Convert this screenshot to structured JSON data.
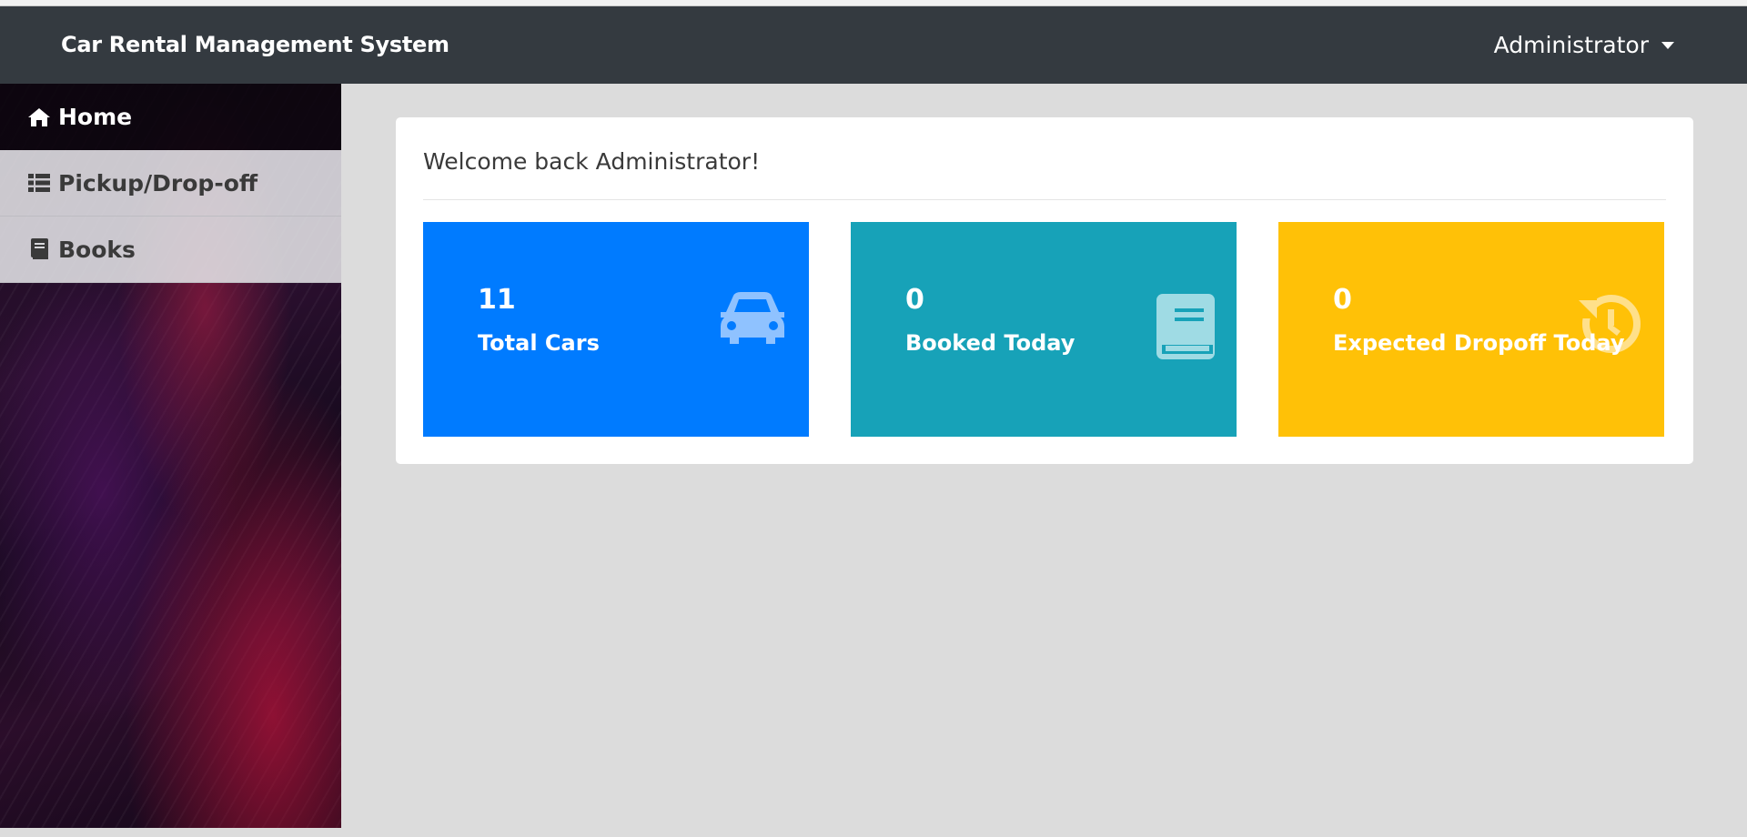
{
  "header": {
    "brand": "Car Rental Management System",
    "user": "Administrator"
  },
  "sidebar": {
    "items": [
      {
        "label": "Home",
        "icon": "home-icon",
        "active": true
      },
      {
        "label": "Pickup/Drop-off",
        "icon": "list-icon",
        "active": false
      },
      {
        "label": "Books",
        "icon": "book-icon",
        "active": false
      }
    ]
  },
  "main": {
    "welcome": "Welcome back Administrator!",
    "cards": [
      {
        "value": "11",
        "label": "Total Cars",
        "color": "#007bff",
        "icon": "car-icon"
      },
      {
        "value": "0",
        "label": "Booked Today",
        "color": "#17a2b8",
        "icon": "book-icon"
      },
      {
        "value": "0",
        "label": "Expected Dropoff Today",
        "color": "#ffc107",
        "icon": "history-icon"
      }
    ]
  },
  "colors": {
    "navbar": "#343a40",
    "page_bg": "#dcdcdc",
    "primary": "#007bff",
    "info": "#17a2b8",
    "warning": "#ffc107"
  }
}
